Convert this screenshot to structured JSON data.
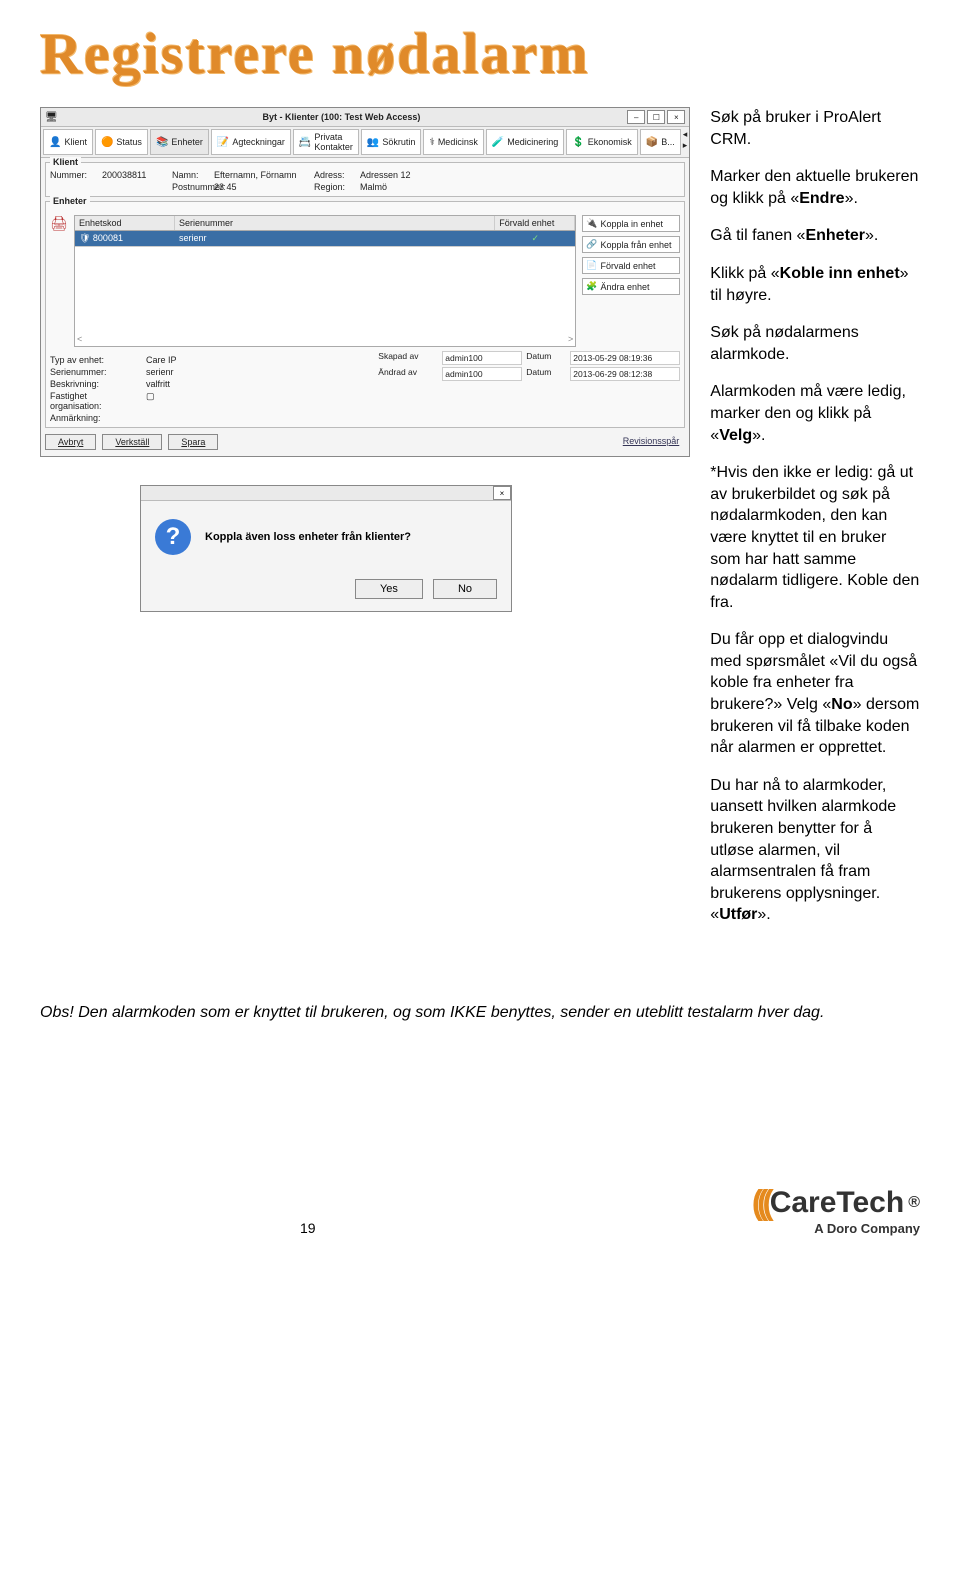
{
  "heading": "Registrere nødalarm",
  "window": {
    "title": "Byt - Klienter (100: Test Web Access)",
    "win_controls": {
      "min": "–",
      "max": "☐",
      "close": "×"
    },
    "tabs": [
      {
        "icon": "👤",
        "label": "Klient"
      },
      {
        "icon": "🟠",
        "label": "Status"
      },
      {
        "icon": "📚",
        "label": "Enheter"
      },
      {
        "icon": "📝",
        "label": "Agteckningar"
      },
      {
        "icon": "📇",
        "label": "Privata Kontakter"
      },
      {
        "icon": "👥",
        "label": "Sökrutin"
      },
      {
        "icon": "⚕",
        "label": "Medicinsk"
      },
      {
        "icon": "🧪",
        "label": "Medicinering"
      },
      {
        "icon": "💲",
        "label": "Ekonomisk"
      },
      {
        "icon": "📦",
        "label": "B..."
      }
    ],
    "klient_legend": "Klient",
    "klient": {
      "nummer_lbl": "Nummer:",
      "nummer": "200038811",
      "namn_lbl": "Namn:",
      "namn": "Efternamn, Förnamn",
      "adress_lbl": "Adress:",
      "adress": "Adressen 12",
      "post_lbl": "Postnummer:",
      "post": "23 45",
      "region_lbl": "Region:",
      "region": "Malmö"
    },
    "enheter_legend": "Enheter",
    "grid_headers": {
      "c1": "Enhetskod",
      "c2": "Serienummer",
      "c3": "Förvald enhet"
    },
    "grid_row": {
      "c1": "🛡 800081",
      "c2": "serienr",
      "c3": "✓"
    },
    "side_actions": [
      {
        "icon": "🔌",
        "label": "Koppla in enhet"
      },
      {
        "icon": "🔗",
        "label": "Koppla från enhet"
      },
      {
        "icon": "📄",
        "label": "Förvald enhet"
      },
      {
        "icon": "🧩",
        "label": "Ändra enhet"
      }
    ],
    "details": {
      "typ_lbl": "Typ av enhet:",
      "typ": "Care IP",
      "ser_lbl": "Serienummer:",
      "ser": "serienr",
      "besk_lbl": "Beskrivning:",
      "besk": "valfritt",
      "org_lbl": "Fastighet organisation:",
      "org_box": "▢",
      "anm_lbl": "Anmärkning:"
    },
    "meta": {
      "skap_lbl": "Skapad av",
      "skap_by": "admin100",
      "skap_d_lbl": "Datum",
      "skap_d": "2013-05-29 08:19:36",
      "and_lbl": "Ändrad av",
      "and_by": "admin100",
      "and_d_lbl": "Datum",
      "and_d": "2013-06-29 08:12:38"
    },
    "bottom_btns": {
      "a": "Avbryt",
      "v": "Verkställ",
      "s": "Spara"
    },
    "rev": "Revisionsspår"
  },
  "dialog": {
    "close": "×",
    "text": "Koppla även loss enheter från klienter?",
    "yes": "Yes",
    "no": "No"
  },
  "instructions": {
    "p1": "Søk på bruker i ProAlert CRM.",
    "p2a": "Marker den aktuelle brukeren og klikk på «",
    "p2b": "Endre",
    "p2c": "».",
    "p3a": "Gå til fanen «",
    "p3b": "Enheter",
    "p3c": "».",
    "p4a": "Klikk på «",
    "p4b": "Koble inn enhet",
    "p4c": "» til høyre.",
    "p5": "Søk på nødalarmens alarmkode.",
    "p6a": "Alarmkoden må være ledig, marker den og klikk på «",
    "p6b": "Velg",
    "p6c": "».",
    "p7": "*Hvis den ikke er ledig: gå ut av brukerbildet og søk på nødalarmkoden, den kan være knyttet til en bruker som har hatt samme nødalarm tidligere. Koble den fra.",
    "p8a": "Du får opp et dialogvindu med spørsmålet «Vil du også koble fra enheter fra brukere?» Velg «",
    "p8b": "No",
    "p8c": "» dersom brukeren vil få tilbake koden når alarmen er opprettet.",
    "p9a": "Du har nå to alarmkoder, uansett hvilken alarmkode brukeren benytter for å utløse alarmen, vil alarmsentralen få fram brukerens opplysninger. «",
    "p9b": "Utfør",
    "p9c": "»."
  },
  "obs": "Obs! Den alarmkoden som er knyttet til brukeren, og som IKKE benyttes, sender en uteblitt testalarm hver dag.",
  "footer": {
    "pagenum": "19",
    "logo_word": "CareTech",
    "logo_sub": "A Doro Company",
    "reg": "®"
  }
}
